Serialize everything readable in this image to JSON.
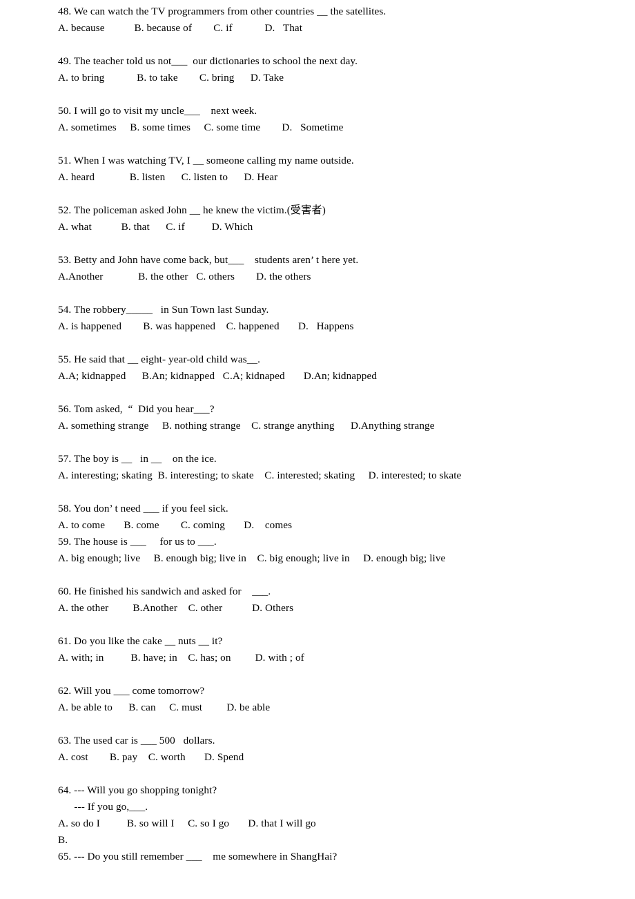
{
  "document": {
    "type": "multiple-choice-worksheet",
    "language": "English with Chinese gloss",
    "first_question_number": 48,
    "last_question_number": 65
  },
  "questions": [
    {
      "id": "q48",
      "number": "48.",
      "stem": "48. We can watch the TV programmers from other countries __ the satellites.",
      "options": "A. because           B. because of        C. if            D.   That",
      "gap_after": true
    },
    {
      "id": "q49",
      "number": "49.",
      "stem": "49. The teacher told us not___  our dictionaries to school the next day.",
      "options": "A. to bring            B. to take        C. bring      D. Take",
      "gap_after": true
    },
    {
      "id": "q50",
      "number": "50.",
      "stem": "50. I will go to visit my uncle___    next week.",
      "options": "A. sometimes     B. some times     C. some time        D.   Sometime",
      "gap_after": true
    },
    {
      "id": "q51",
      "number": "51.",
      "stem": "51. When I was watching TV, I __ someone calling my name outside.",
      "options": "A. heard             B. listen      C. listen to      D. Hear",
      "gap_after": true
    },
    {
      "id": "q52",
      "number": "52.",
      "stem": "52. The policeman asked John __ he knew the victim.(受害者)",
      "options": "A. what           B. that      C. if          D. Which",
      "gap_after": true
    },
    {
      "id": "q53",
      "number": "53.",
      "stem": "53. Betty and John have come back, but___    students aren’ t here yet.",
      "options": "A.Another             B. the other   C. others        D. the others",
      "gap_after": true
    },
    {
      "id": "q54",
      "number": "54.",
      "stem": "54. The robbery_____   in Sun Town last Sunday.",
      "options": "A. is happened        B. was happened    C. happened       D.   Happens",
      "gap_after": true
    },
    {
      "id": "q55",
      "number": "55.",
      "stem": "55. He said that __ eight- year-old child was__.",
      "options": "A.A; kidnapped      B.An; kidnapped   C.A; kidnaped       D.An; kidnapped",
      "gap_after": true
    },
    {
      "id": "q56",
      "number": "56.",
      "stem": "56. Tom asked,  “  Did you hear___?",
      "options": "A. something strange     B. nothing strange    C. strange anything      D.Anything strange",
      "gap_after": true
    },
    {
      "id": "q57",
      "number": "57.",
      "stem": "57. The boy is __   in __    on the ice.",
      "options": "A. interesting; skating  B. interesting; to skate    C. interested; skating     D. interested; to skate",
      "gap_after": true
    },
    {
      "id": "q58",
      "number": "58.",
      "stem": "58. You don’ t need ___ if you feel sick.",
      "options": "A. to come       B. come        C. coming       D.    comes",
      "gap_after": false
    },
    {
      "id": "q59",
      "number": "59.",
      "stem": "59. The house is ___     for us to ___.",
      "options": "A. big enough; live     B. enough big; live in    C. big enough; live in     D. enough big; live",
      "gap_after": true
    },
    {
      "id": "q60",
      "number": "60.",
      "stem": "60. He finished his sandwich and asked for    ___.",
      "options": "A. the other         B.Another    C. other           D. Others",
      "gap_after": true
    },
    {
      "id": "q61",
      "number": "61.",
      "stem": "61. Do you like the cake __ nuts __ it?",
      "options": "A. with; in          B. have; in    C. has; on         D. with ; of",
      "gap_after": true
    },
    {
      "id": "q62",
      "number": "62.",
      "stem": "62. Will you ___ come tomorrow?",
      "options": "A. be able to      B. can     C. must         D. be able",
      "gap_after": true
    },
    {
      "id": "q63",
      "number": "63.",
      "stem": "63. The used car is ___ 500   dollars.",
      "options": "A. cost        B. pay    C. worth       D. Spend",
      "gap_after": true
    },
    {
      "id": "q64",
      "number": "64.",
      "stem": "64. --- Will you go shopping tonight?",
      "stem_line2": "      --- If you go,___.",
      "options": "A. so do I          B. so will I     C. so I go       D. that I will go",
      "stray": "B.",
      "gap_after": false
    },
    {
      "id": "q65",
      "number": "65.",
      "stem": "65. --- Do you still remember ___    me somewhere in ShangHai?",
      "options": "",
      "gap_after": false
    }
  ]
}
